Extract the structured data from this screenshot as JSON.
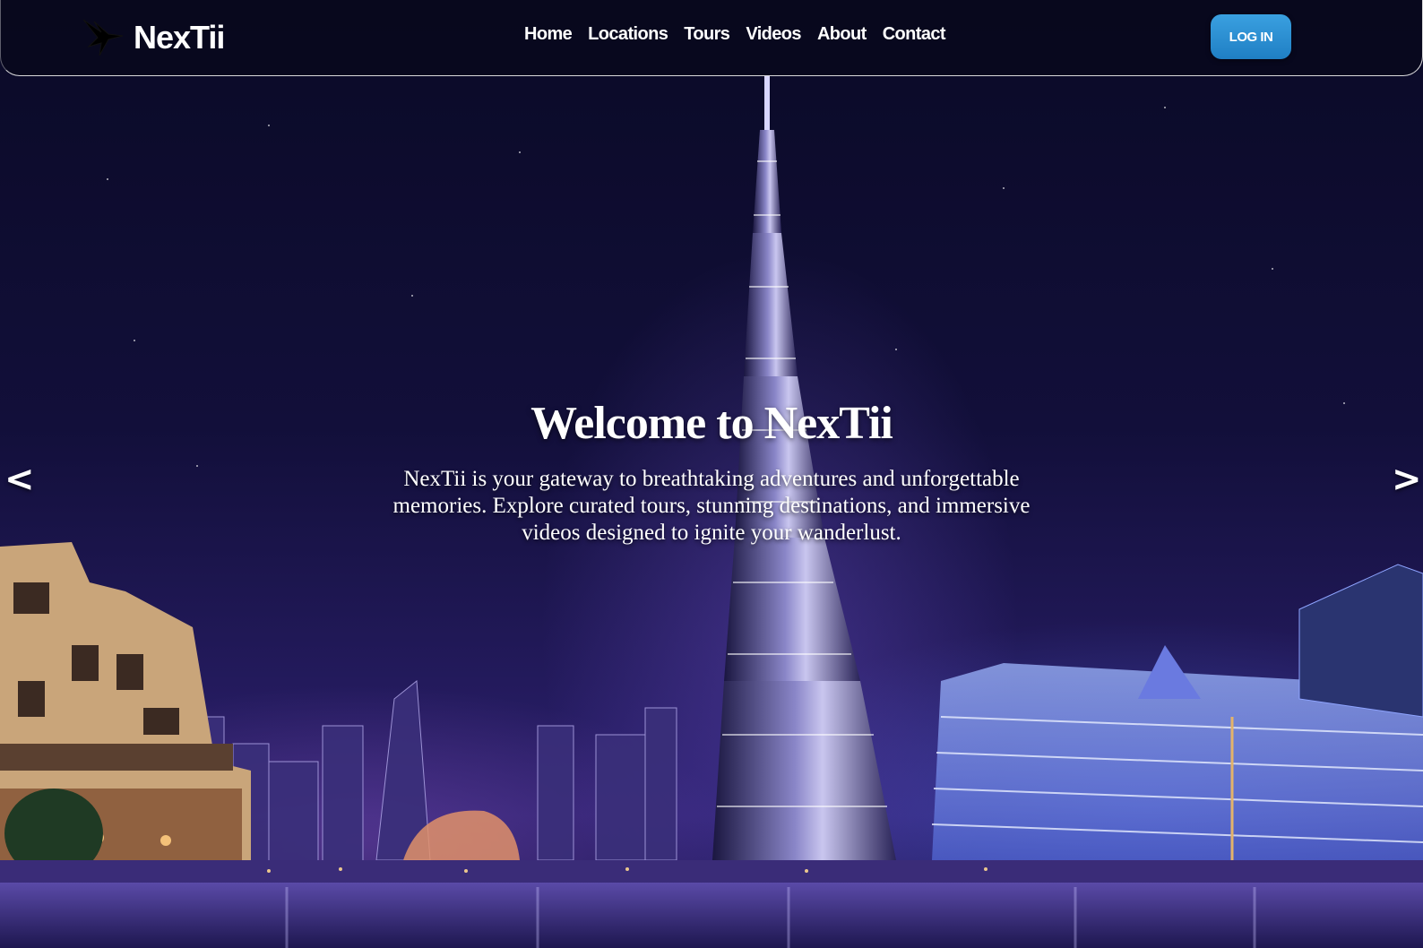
{
  "brand": {
    "name": "NexTii",
    "logo_icon": "bird-logo-icon"
  },
  "nav": {
    "links": [
      "Home",
      "Locations",
      "Tours",
      "Videos",
      "About",
      "Contact"
    ],
    "login_label": "LOG IN"
  },
  "hero": {
    "title": "Welcome to NexTii",
    "description": "NexTii is your gateway to breathtaking adventures and unforgettable memories. Explore curated tours, stunning destinations, and immersive videos designed to ignite your wanderlust.",
    "background": "Night city skyline with illuminated skyscraper tower and waterfront"
  },
  "slider": {
    "prev_label": "<",
    "next_label": ">"
  },
  "colors": {
    "navbar_bg": "#08081c",
    "login_button": "#2a8fd6",
    "text": "#ffffff",
    "sky_top": "#0a0a26",
    "sky_bottom": "#2d2170"
  }
}
